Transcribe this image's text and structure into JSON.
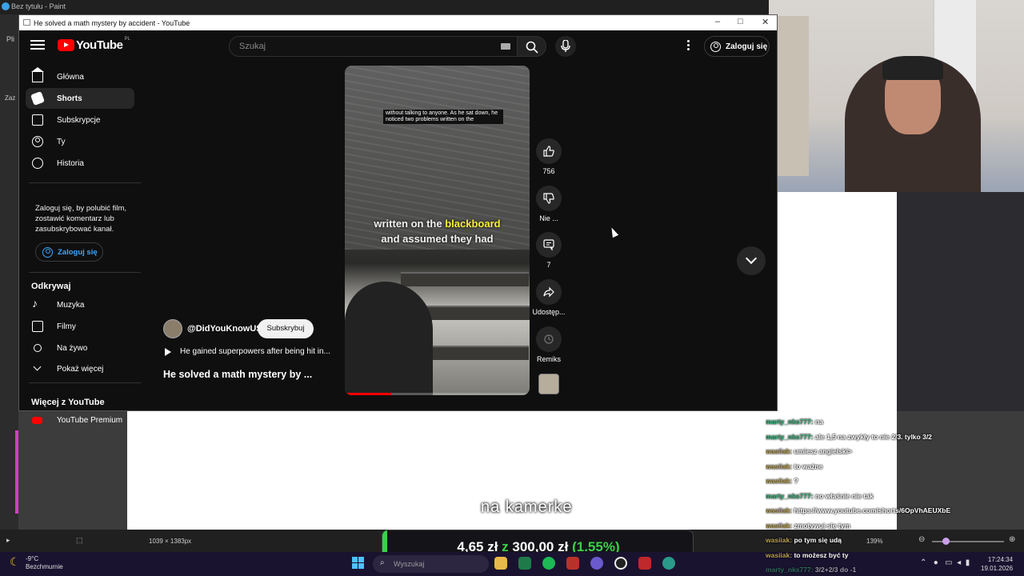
{
  "paint": {
    "title": "Bez tytułu - Paint",
    "menu_hint": "Pli",
    "side_hint": "Zaz",
    "canvas_size": "1039 × 1383px",
    "zoom": "139%"
  },
  "browser": {
    "window_title": "He solved a math mystery by accident - YouTube"
  },
  "youtube": {
    "logo_text": "YouTube",
    "country_code": "PL",
    "search_placeholder": "Szukaj",
    "signin_label": "Zaloguj się",
    "nav": [
      {
        "label": "Główna",
        "icon": "home-icon"
      },
      {
        "label": "Shorts",
        "icon": "shorts-icon"
      },
      {
        "label": "Subskrypcje",
        "icon": "subscriptions-icon"
      },
      {
        "label": "Ty",
        "icon": "user-icon"
      },
      {
        "label": "Historia",
        "icon": "history-icon"
      }
    ],
    "signin_prompt": "Zaloguj się, by polubić film, zostawić komentarz lub zasubskrybować kanał.",
    "explore_title": "Odkrywaj",
    "explore": [
      {
        "label": "Muzyka",
        "icon": "music-icon"
      },
      {
        "label": "Filmy",
        "icon": "film-icon"
      },
      {
        "label": "Na żywo",
        "icon": "live-icon"
      },
      {
        "label": "Pokaż więcej",
        "icon": "chevron-down-icon"
      }
    ],
    "more_title": "Więcej z YouTube",
    "more": [
      {
        "label": "YouTube Premium",
        "icon": "youtube-premium-icon"
      }
    ]
  },
  "short": {
    "subtitle_box": "without talking to anyone. As he sat down, he noticed two problems written on the",
    "caption_line1_a": "written on the ",
    "caption_line1_b": "blackboard",
    "caption_line2": "and assumed they had",
    "progress": 0.25,
    "channel": "@DidYouKnowUS",
    "subscribe": "Subskrybuj",
    "related": "He gained superpowers after being hit in...",
    "title": "He solved a math mystery by ...",
    "actions": {
      "likes": "756",
      "dislike": "Nie ...",
      "comments": "7",
      "share": "Udostęp...",
      "remix": "Remiks"
    }
  },
  "chat": [
    {
      "user": "marty_nks777:",
      "msg": "na",
      "style": "green"
    },
    {
      "user": "marty_nks777:",
      "msg": "ale 1,5 na zwykły to nie 2/3. tylko 3/2",
      "style": "green"
    },
    {
      "user": "wasiiak:",
      "msg": "umiesz angielski>",
      "style": "gold"
    },
    {
      "user": "wasiiak:",
      "msg": "to ważne",
      "style": "gold"
    },
    {
      "user": "wasiiak:",
      "msg": "?",
      "style": "gold"
    },
    {
      "user": "marty_nks777:",
      "msg": "no właśnie nie tak",
      "style": "green"
    },
    {
      "user": "wasiiak:",
      "msg": "https://www.youtube.com/shorts/6OpVhAEUXbE",
      "style": "gold"
    },
    {
      "user": "wasiiak:",
      "msg": "zmotywuj się tym",
      "style": "gold"
    },
    {
      "user": "wasiiak:",
      "msg": "po tym się udą",
      "style": "gold"
    },
    {
      "user": "wasiiak:",
      "msg": "to możesz być ty",
      "style": "gold"
    },
    {
      "user": "marty_nks777:",
      "msg": "3/2+2/3 do -1",
      "style": "green"
    }
  ],
  "overlay": {
    "camera_text": "na kamerke",
    "donation_current": "4,65 zł",
    "donation_sep": " z ",
    "donation_goal": "300,00 zł",
    "donation_percent": "(1.55%)",
    "donation_fraction": 0.0155
  },
  "taskbar": {
    "temp": "-9°C",
    "weather": "Bezchmurnie",
    "search_placeholder": "Wyszukaj",
    "time": "17:24:34",
    "date": "19.01.2026"
  },
  "colors": {
    "yt_red": "#ff0000",
    "link_blue": "#3ea6ff",
    "caption_highlight": "#f7ef3a",
    "donation_green": "#3bd14a",
    "chat_green": "#3cb37a",
    "chat_gold": "#b8a250"
  }
}
